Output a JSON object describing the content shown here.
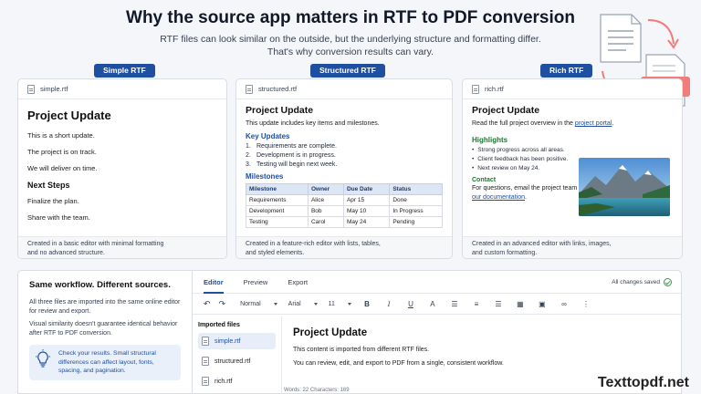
{
  "header": {
    "title": "Why the source app matters in RTF to PDF conversion",
    "subtitle_line1": "RTF files can look similar on the outside, but the underlying structure and formatting differ.",
    "subtitle_line2": "That's why conversion results can vary.",
    "pdf_label": "PDF"
  },
  "cards": {
    "simple": {
      "badge": "Simple RTF",
      "filename": "simple.rtf",
      "title": "Project Update",
      "lines": [
        "This is a short update.",
        "The project is on track.",
        "We will deliver on time."
      ],
      "section": "Next Steps",
      "steps": [
        "Finalize the plan.",
        "Share with the team."
      ],
      "footer_line1": "Created in a basic editor with minimal formatting",
      "footer_line2": "and no advanced structure."
    },
    "structured": {
      "badge": "Structured RTF",
      "filename": "structured.rtf",
      "title": "Project Update",
      "intro": "This update includes key items and milestones.",
      "key_heading": "Key Updates",
      "updates": [
        {
          "n": "1.",
          "text": "Requirements are complete."
        },
        {
          "n": "2.",
          "text": "Development is in progress."
        },
        {
          "n": "3.",
          "text": "Testing will begin next week."
        }
      ],
      "milestones_heading": "Milestones",
      "table_headers": [
        "Milestone",
        "Owner",
        "Due Date",
        "Status"
      ],
      "table_rows": [
        [
          "Requirements",
          "Alice",
          "Apr 15",
          "Done"
        ],
        [
          "Development",
          "Bob",
          "May 10",
          "In Progress"
        ],
        [
          "Testing",
          "Carol",
          "May 24",
          "Pending"
        ]
      ],
      "footer_line1": "Created in a feature-rich editor with lists, tables,",
      "footer_line2": "and styled elements."
    },
    "rich": {
      "badge": "Rich RTF",
      "filename": "rich.rtf",
      "title": "Project Update",
      "intro_prefix": "Read the full project overview in the ",
      "intro_link": "project portal",
      "intro_suffix": ".",
      "highlights_heading": "Highlights",
      "highlights": [
        "Strong progress across all areas.",
        "Client feedback has been positive.",
        "Next review on May 24."
      ],
      "contact_heading": "Contact",
      "contact_text": "For questions, email the project team or visit",
      "contact_link": "our documentation",
      "contact_suffix": ".",
      "footer_line1": "Created in an advanced editor with links, images,",
      "footer_line2": "and custom formatting."
    }
  },
  "bottom": {
    "heading": "Same workflow. Different sources.",
    "p1": "All three files are imported into the same online editor for review and export.",
    "p2": "Visual similarity doesn't guarantee identical behavior after RTF to PDF conversion.",
    "tip": "Check your results. Small structural differences can affect layout, fonts, spacing, and pagination."
  },
  "editor": {
    "tabs": [
      "Editor",
      "Preview",
      "Export"
    ],
    "saved": "All changes saved",
    "style_select": "Normal",
    "font_select": "Arial",
    "size_select": "11",
    "files_heading": "Imported files",
    "files": [
      "simple.rtf",
      "structured.rtf",
      "rich.rtf"
    ],
    "doc_title": "Project Update",
    "doc_p1": "This content is imported from different RTF files.",
    "doc_p2": "You can review, edit, and export to PDF from a single, consistent workflow.",
    "status": "Words: 22     Characters: 169"
  },
  "watermark": "Texttopdf.net",
  "colors": {
    "accent": "#1e4fa0",
    "green": "#1a7a30",
    "pdf": "#f07c7c"
  }
}
